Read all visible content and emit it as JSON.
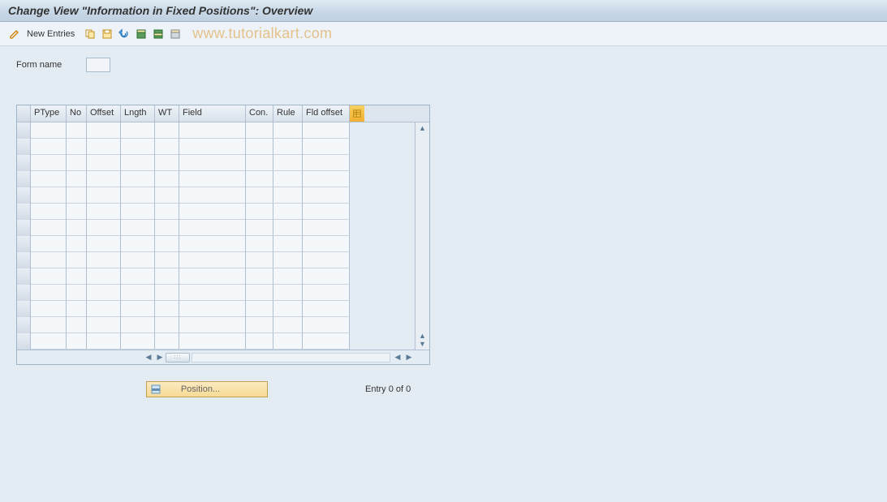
{
  "header": {
    "title": "Change View \"Information in Fixed Positions\": Overview"
  },
  "toolbar": {
    "new_entries_label": "New Entries"
  },
  "watermark": "www.tutorialkart.com",
  "form": {
    "name_label": "Form name",
    "name_value": ""
  },
  "table": {
    "columns": {
      "ptype": "PType",
      "no": "No",
      "offset": "Offset",
      "lngth": "Lngth",
      "wt": "WT",
      "field": "Field",
      "con": "Con.",
      "rule": "Rule",
      "fldoffset": "Fld offset"
    },
    "rows": []
  },
  "footer": {
    "position_label": "Position...",
    "entry_status": "Entry 0 of 0"
  },
  "icons": {
    "pencil": "pencil-icon",
    "copy": "copy-icon",
    "save_var": "save-variant-icon",
    "undo": "undo-icon",
    "select_all": "select-all-icon",
    "select_block": "select-block-icon",
    "deselect": "deselect-icon",
    "settings": "table-settings-icon",
    "position": "position-icon"
  }
}
